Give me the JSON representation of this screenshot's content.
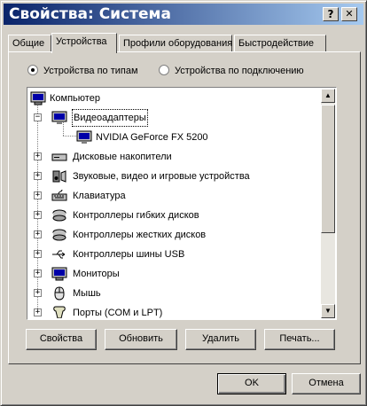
{
  "window": {
    "title": "Свойства: Система",
    "help_label": "?",
    "close_label": "✕"
  },
  "tabs": [
    "Общие",
    "Устройства",
    "Профили оборудования",
    "Быстродействие"
  ],
  "active_tab": "Устройства",
  "view": {
    "by_type": "Устройства по типам",
    "by_connection": "Устройства по подключению",
    "selected": "by_type"
  },
  "tree": {
    "root": "Компьютер",
    "items": [
      {
        "label": "Видеоадаптеры",
        "expanded": true,
        "icon": "display-adapter-icon"
      },
      {
        "label": "NVIDIA GeForce FX 5200",
        "child": true,
        "icon": "display-adapter-icon"
      },
      {
        "label": "Дисковые накопители",
        "icon": "disk-drive-icon"
      },
      {
        "label": "Звуковые, видео и игровые устройства",
        "icon": "sound-device-icon"
      },
      {
        "label": "Клавиатура",
        "icon": "keyboard-icon"
      },
      {
        "label": "Контроллеры гибких дисков",
        "icon": "floppy-controller-icon"
      },
      {
        "label": "Контроллеры жестких дисков",
        "icon": "hdd-controller-icon"
      },
      {
        "label": "Контроллеры шины USB",
        "icon": "usb-icon"
      },
      {
        "label": "Мониторы",
        "icon": "monitor-icon"
      },
      {
        "label": "Мышь",
        "icon": "mouse-icon"
      },
      {
        "label": "Порты (COM и LPT)",
        "icon": "port-icon"
      }
    ]
  },
  "actions": {
    "properties": "Свойства",
    "refresh": "Обновить",
    "remove": "Удалить",
    "print": "Печать..."
  },
  "dialog": {
    "ok": "OK",
    "cancel": "Отмена"
  }
}
